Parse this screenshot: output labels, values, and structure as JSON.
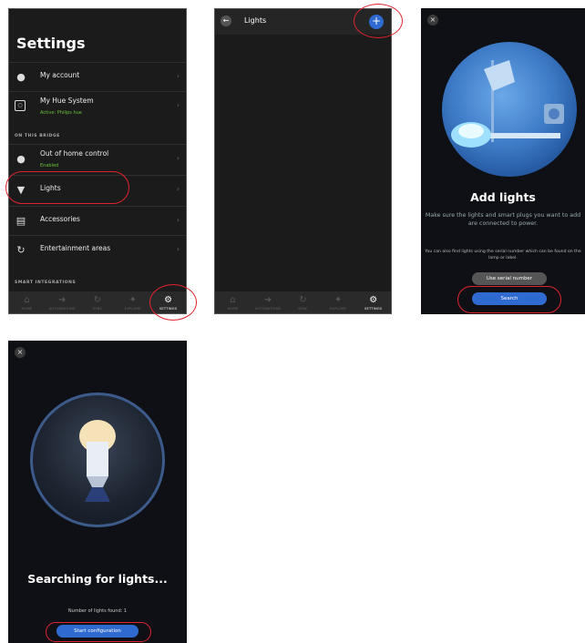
{
  "settings": {
    "title": "Settings",
    "items": [
      {
        "label": "My account",
        "icon": "person-icon"
      },
      {
        "label": "My Hue System",
        "sub": "Active: Philips hue",
        "icon": "bridge-icon"
      },
      {
        "label": "Out of home control",
        "sub": "Enabled",
        "icon": "person-icon"
      },
      {
        "label": "Lights",
        "icon": "bulb-icon"
      },
      {
        "label": "Accessories",
        "icon": "remote-icon"
      },
      {
        "label": "Entertainment areas",
        "icon": "sync-icon"
      }
    ],
    "section_bridge": "ON THIS BRIDGE",
    "section_smart": "SMART INTEGRATIONS"
  },
  "tabs": [
    "HOME",
    "AUTOMATIONS",
    "SYNC",
    "EXPLORE",
    "SETTINGS"
  ],
  "lights_screen": {
    "title": "Lights",
    "add": "+"
  },
  "add_lights": {
    "title": "Add lights",
    "desc": "Make sure the lights and smart plugs you want to add are connected to power.",
    "hint": "You can also find lights using the serial number which can be found on the lamp or label.",
    "serial_btn": "Use serial number",
    "search_btn": "Search"
  },
  "searching": {
    "title": "Searching for lights...",
    "count_text": "Number of lights found: 1",
    "start_btn": "Start configuration"
  },
  "colors": {
    "accent": "#2f6ad0",
    "highlight": "#e0242d",
    "enabled": "#67c23a"
  }
}
